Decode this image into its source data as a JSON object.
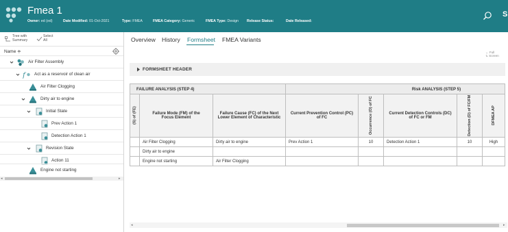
{
  "header": {
    "title": "Fmea 1",
    "owner_label": "Owner:",
    "owner_value": "ed (ed)",
    "date_modified_label": "Date Modified:",
    "date_modified_value": "01-Oct-2021",
    "type_label": "Type:",
    "type_value": "FMEA",
    "category_label": "FMEA Category:",
    "category_value": "Generic",
    "fmea_type_label": "FMEA Type:",
    "fmea_type_value": "Design",
    "release_status_label": "Release Status:",
    "date_released_label": "Date Released:",
    "right_initial": "S",
    "color": "#1f7d86"
  },
  "left_panel": {
    "tree_with_summary_line1": "Tree with",
    "tree_with_summary_line2": "Summary",
    "select_all_line1": "Select",
    "select_all_line2": "All",
    "name_header": "Name ≑",
    "tree": [
      {
        "label": "Air Filter Assembly",
        "icon": "assembly-icon",
        "chevron": "down"
      },
      {
        "label": "Act as a reservoir of clean air",
        "icon": "function-icon",
        "chevron": "down"
      },
      {
        "label": "Air Filter Clogging",
        "icon": "failure-icon",
        "chevron": "none"
      },
      {
        "label": "Dirty air to engine",
        "icon": "failure-icon",
        "chevron": "down"
      },
      {
        "label": "Initial State",
        "icon": "document-icon",
        "chevron": "down"
      },
      {
        "label": "Prev Action 1",
        "icon": "action-document-icon",
        "chevron": "none"
      },
      {
        "label": "Detection Action 1",
        "icon": "action-document-icon",
        "chevron": "none"
      },
      {
        "label": "Revision State",
        "icon": "document-icon",
        "chevron": "down"
      },
      {
        "label": "Action 11",
        "icon": "action-document-icon",
        "chevron": "none"
      },
      {
        "label": "Engine not starting",
        "icon": "failure-icon",
        "chevron": "none"
      }
    ]
  },
  "tabs": [
    "Overview",
    "History",
    "Formsheet",
    "FMEA Variants"
  ],
  "active_tab": "Formsheet",
  "fullscreen_line1": "← Full",
  "fullscreen_line2": "↳ Screen",
  "formsheet_header": "FORMSHEET HEADER",
  "table": {
    "step4_label": "FAILURE ANALYSIS (STEP 4)",
    "step5_label": "Risk ANALYSIS (STEP 5)",
    "col_cut": "(S) of (FE)",
    "col_fm": "Failure Mode (FM) of the Focus Element",
    "col_fc": "Failure Cause (FC) of the Next Lower Element of Characteristic",
    "col_pc": "Current Prevention Control (PC) of FC",
    "col_occ": "Occurrence (O) of FC",
    "col_dc": "Current Detection Controls (DC) of FC or FM",
    "col_det": "Detection (D) of FC/FM",
    "col_ap": "DFMEA AP",
    "rows": [
      {
        "fm": "Air Filter Clogging",
        "fc": "Dirty air to engine",
        "pc": "Prev Action 1",
        "occ": "10",
        "dc": "Detection Action 1",
        "det": "10",
        "ap": "High"
      },
      {
        "fm": "Dirty air to engine",
        "fc": "",
        "pc": "",
        "occ": "",
        "dc": "",
        "det": "",
        "ap": ""
      },
      {
        "fm": "Engine not starting",
        "fc": "Air Filter Clogging",
        "pc": "",
        "occ": "",
        "dc": "",
        "det": "",
        "ap": ""
      }
    ]
  }
}
